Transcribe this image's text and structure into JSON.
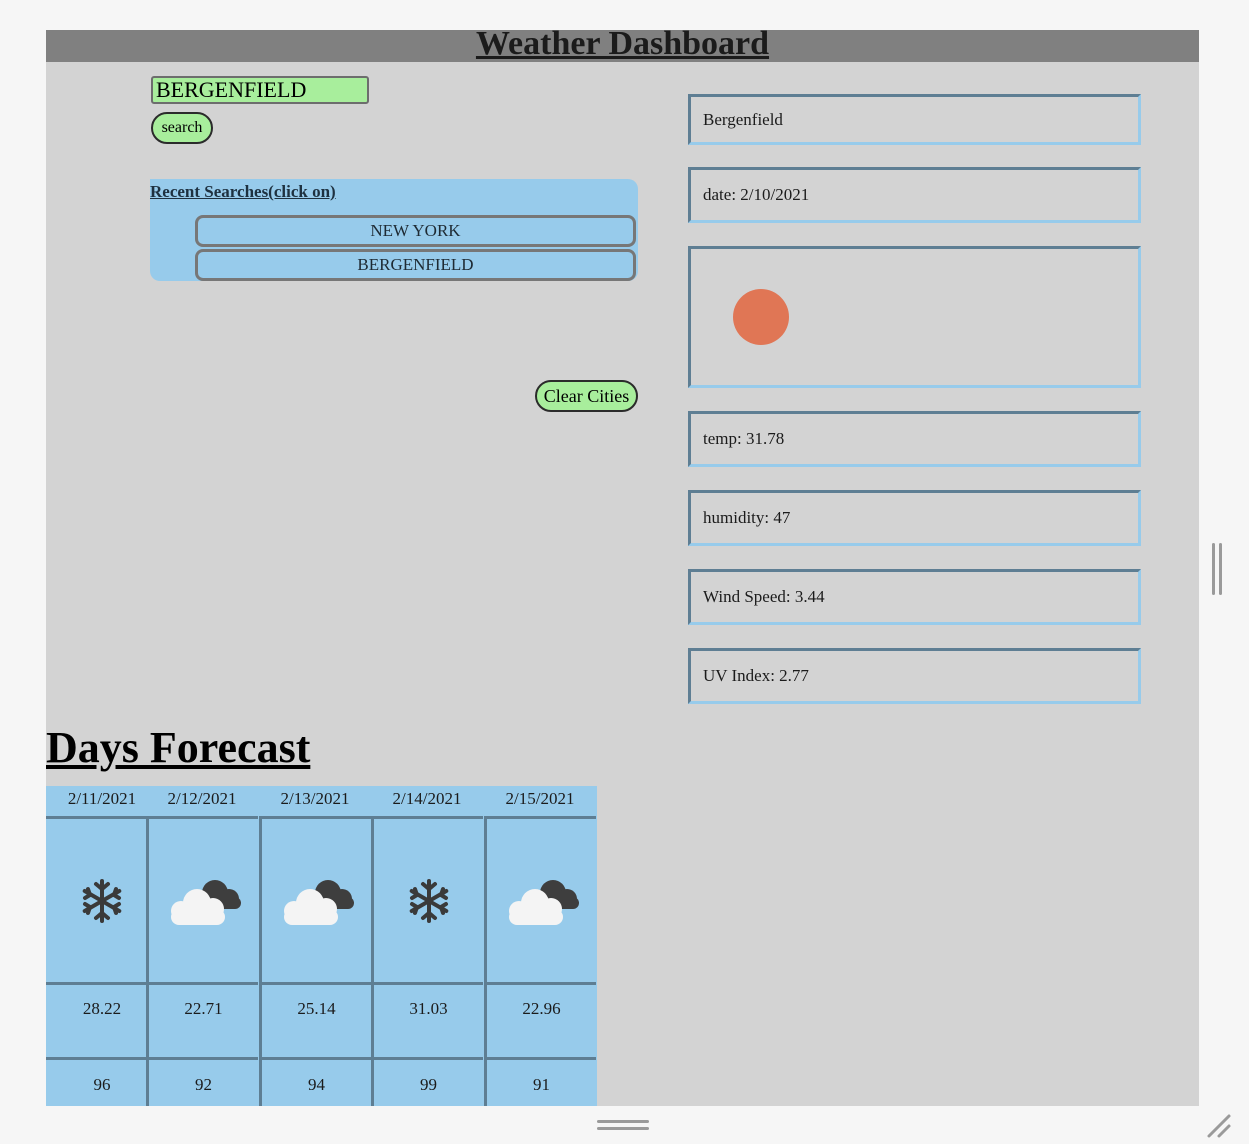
{
  "header": {
    "title": "Weather Dashboard"
  },
  "search": {
    "value": "BERGENFIELD",
    "button_label": "search"
  },
  "recent": {
    "title": "Recent Searches(click on)",
    "items": [
      "NEW YORK",
      "BERGENFIELD"
    ],
    "clear_label": "Clear Cities"
  },
  "current": {
    "city": "Bergenfield",
    "date": "date: 2/10/2021",
    "icon": "sun-icon",
    "temp": "temp: 31.78",
    "humidity": "humidity: 47",
    "wind": "Wind Speed: 3.44",
    "uv": "UV Index: 2.77"
  },
  "forecast": {
    "title": "Days Forecast",
    "days": [
      {
        "date": "2/11/2021",
        "icon": "snowflake-icon",
        "temp": "28.22",
        "humidity": "96"
      },
      {
        "date": "2/12/2021",
        "icon": "cloud-icon",
        "temp": "22.71",
        "humidity": "92"
      },
      {
        "date": "2/13/2021",
        "icon": "cloud-icon",
        "temp": "25.14",
        "humidity": "94"
      },
      {
        "date": "2/14/2021",
        "icon": "snowflake-icon",
        "temp": "31.03",
        "humidity": "99"
      },
      {
        "date": "2/15/2021",
        "icon": "cloud-icon",
        "temp": "22.96",
        "humidity": "91"
      }
    ]
  },
  "colors": {
    "header_bg": "#808080",
    "page_bg": "#d3d3d3",
    "accent_green": "#a8ee9c",
    "accent_blue": "#97cbeb",
    "sun": "#e07655"
  }
}
